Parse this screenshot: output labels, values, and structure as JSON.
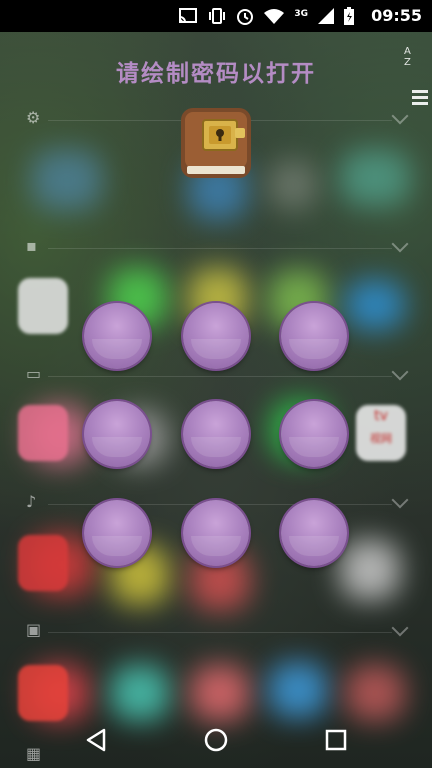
{
  "status_bar": {
    "time": "09:55",
    "network_type": "3G",
    "icons": [
      "cast-icon",
      "vibrate-icon",
      "alarm-icon",
      "wifi-icon",
      "signal-icon",
      "battery-icon"
    ]
  },
  "lock_screen": {
    "title": "请绘制密码以打开",
    "app_icon": "locked-diary-icon",
    "pattern_dots": [
      {
        "row": 1,
        "col": 1
      },
      {
        "row": 1,
        "col": 2
      },
      {
        "row": 1,
        "col": 3
      },
      {
        "row": 2,
        "col": 1
      },
      {
        "row": 2,
        "col": 2
      },
      {
        "row": 2,
        "col": 3
      },
      {
        "row": 3,
        "col": 1
      },
      {
        "row": 3,
        "col": 2
      },
      {
        "row": 3,
        "col": 3
      }
    ],
    "dot_color": "#ac84c1",
    "title_color": "#b48cc4"
  },
  "background": {
    "az_index_label": "A Z",
    "tv_badge_text": "tv",
    "tv_badge_sub": "视网"
  },
  "nav_bar": {
    "buttons": [
      "back-icon",
      "home-icon",
      "recents-icon"
    ]
  }
}
